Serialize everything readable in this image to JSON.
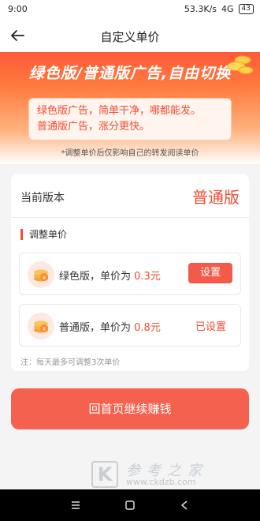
{
  "status": {
    "time": "9:00",
    "speed": "53.3K/s",
    "network": "4G",
    "battery": "43"
  },
  "header": {
    "title": "自定义单价"
  },
  "banner": {
    "headline": "绿色版/普通版广告,自由切换",
    "notice_line1": "绿色版广告，简单干净，哪都能发。",
    "notice_line2": "普通版广告，涨分更快。",
    "note": "*调整单价后仅影响自己的转发阅读单价"
  },
  "current": {
    "label": "当前版本",
    "value": "普通版"
  },
  "adjust": {
    "title": "调整单价",
    "rows": [
      {
        "text": "绿色版，单价为",
        "price": "0.3元",
        "action": "设置"
      },
      {
        "text": "普通版，单价为",
        "price": "0.8元",
        "action": "已设置"
      }
    ],
    "footnote": "注：每天最多可调整3次单价"
  },
  "cta": {
    "label": "回首页继续赚钱"
  },
  "watermark": {
    "mark": "K",
    "title": "参考之家",
    "url": "www.ckdzb.com"
  },
  "colors": {
    "accent": "#f04c32",
    "button": "#f45a4a",
    "banner_top": "#ff5a3a"
  },
  "icons": [
    "back-arrow-icon",
    "coin-icon",
    "nav-menu-icon",
    "nav-home-icon",
    "nav-back-icon"
  ]
}
